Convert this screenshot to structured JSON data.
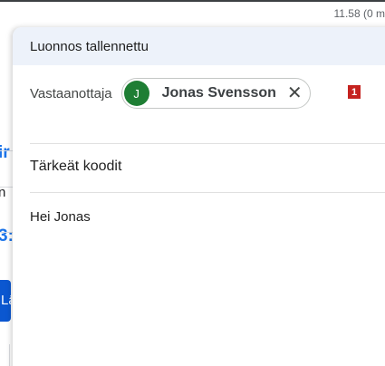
{
  "background": {
    "clock_text": "11.58 (0 m",
    "fragments": [
      "ir",
      "n",
      "3:",
      "Lä"
    ]
  },
  "compose": {
    "title": "Luonnos tallennettu",
    "recipients_label": "Vastaanottaja",
    "recipient": {
      "avatar_letter": "J",
      "name": "Jonas Svensson",
      "remove_glyph": "✕"
    },
    "badge": "1",
    "subject": "Tärkeät koodit",
    "body": "Hei Jonas"
  }
}
